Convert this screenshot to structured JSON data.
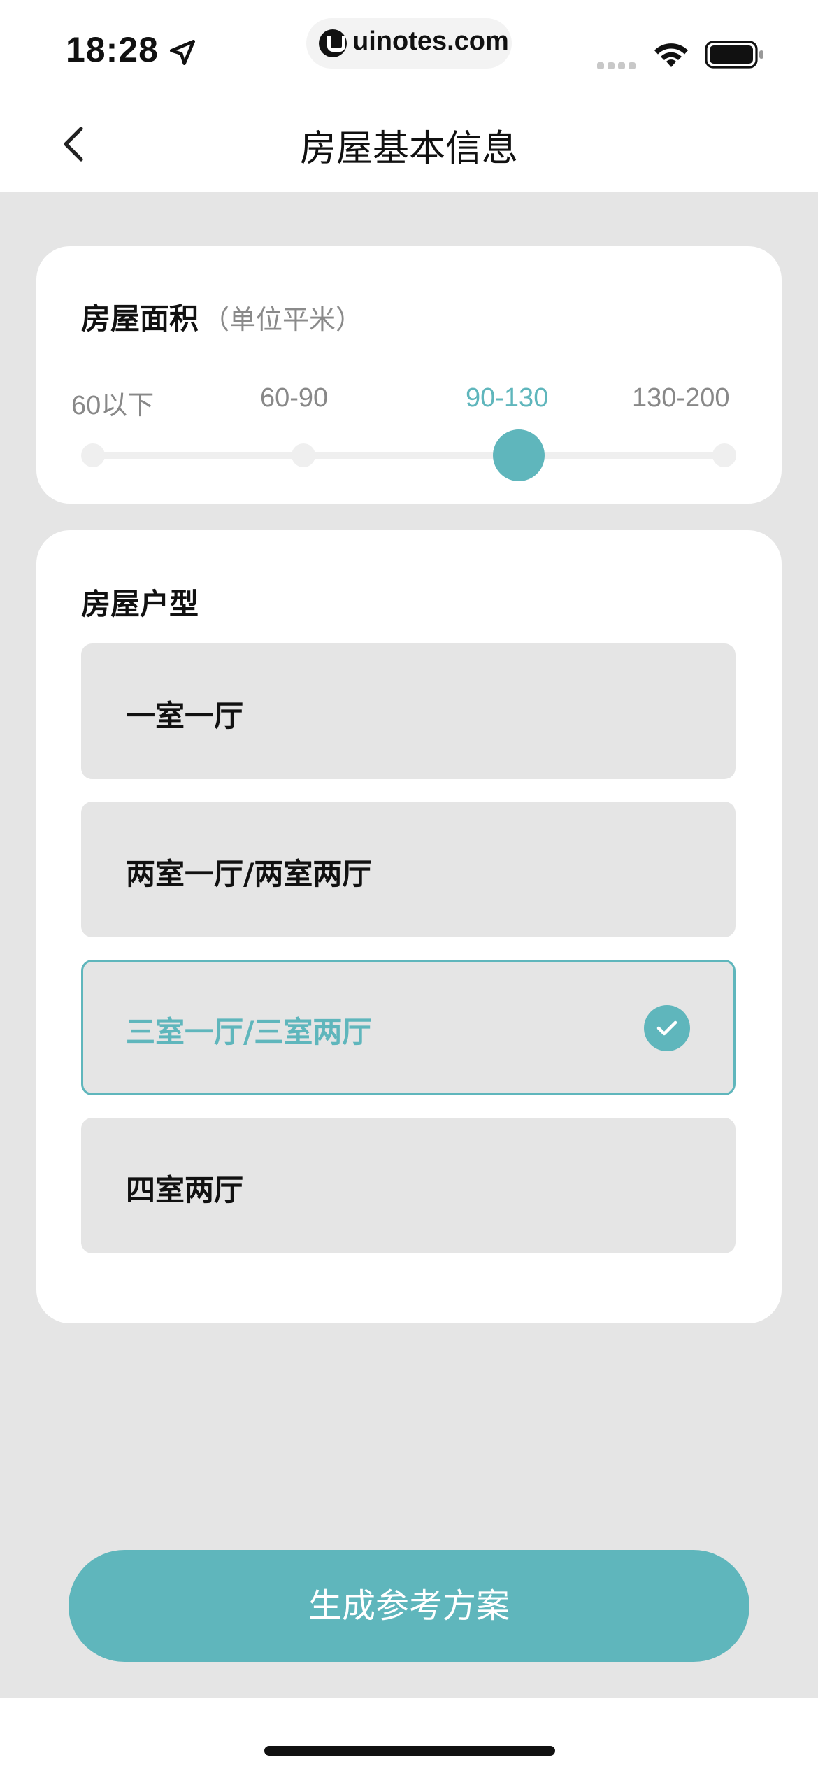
{
  "status_bar": {
    "time": "18:28",
    "url": "uinotes.com",
    "icons": [
      "location-arrow-icon",
      "wifi-icon",
      "battery-icon"
    ]
  },
  "nav": {
    "title": "房屋基本信息",
    "back_icon": "chevron-left-icon"
  },
  "area": {
    "title": "房屋面积",
    "unit_hint": "（单位平米）",
    "options": [
      "60以下",
      "60-90",
      "90-130",
      "130-200"
    ],
    "selected": "90-130"
  },
  "house_type": {
    "title": "房屋户型",
    "options": [
      "一室一厅",
      "两室一厅/两室两厅",
      "三室一厅/三室两厅",
      "四室两厅"
    ],
    "selected": "三室一厅/三室两厅"
  },
  "actions": {
    "generate_label": "生成参考方案"
  },
  "colors": {
    "accent": "#5fb6bc",
    "background": "#e5e5e5",
    "card": "#ffffff"
  }
}
